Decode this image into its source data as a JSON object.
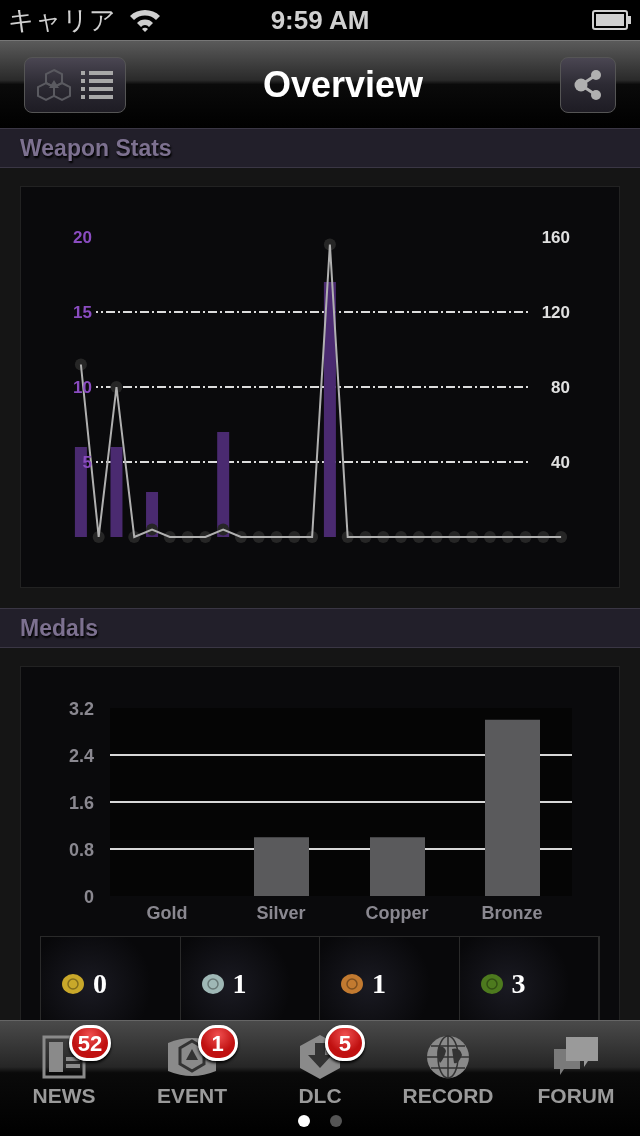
{
  "status_bar": {
    "carrier": "キャリア",
    "time": "9:59 AM"
  },
  "nav_bar": {
    "title": "Overview"
  },
  "sections": [
    {
      "title": "Weapon Stats",
      "chart_data": {
        "type": "bar",
        "ylim": [
          0,
          20
        ],
        "yticks": [
          5,
          10,
          15,
          20
        ],
        "y2lim": [
          0,
          160
        ],
        "y2ticks": [
          40,
          80,
          120,
          160
        ],
        "grid": true,
        "series": [
          {
            "type": "bar",
            "color": "#4a2a70",
            "values": [
              6,
              0,
              6,
              0,
              3,
              0,
              0,
              0,
              7,
              0,
              0,
              0,
              0,
              0,
              17,
              0,
              0,
              0,
              0,
              0,
              0,
              0,
              0,
              0,
              0,
              0,
              0,
              0
            ]
          },
          {
            "type": "line",
            "axis": "y2",
            "marker": true,
            "color": "#b0b0b0",
            "values": [
              92,
              0,
              80,
              0,
              4,
              0,
              0,
              0,
              4,
              0,
              0,
              0,
              0,
              0,
              156,
              0,
              0,
              0,
              0,
              0,
              0,
              0,
              0,
              0,
              0,
              0,
              0,
              0
            ]
          }
        ]
      }
    },
    {
      "title": "Medals",
      "chart_data": {
        "type": "bar",
        "categories": [
          "Gold",
          "Silver",
          "Copper",
          "Bronze"
        ],
        "ylim": [
          0,
          3.2
        ],
        "yticks": [
          0,
          0.8,
          1.6,
          2.4,
          3.2
        ],
        "grid": true,
        "series": [
          {
            "color": "#5a5a5c",
            "values": [
              0,
              1,
              1,
              3
            ]
          }
        ]
      },
      "medals": [
        {
          "count": "0",
          "color": "#c9a82a"
        },
        {
          "count": "1",
          "color": "#9fb8b6"
        },
        {
          "count": "1",
          "color": "#c27a30"
        },
        {
          "count": "3",
          "color": "#4d7a1e"
        }
      ]
    }
  ],
  "tab_bar": {
    "items": [
      {
        "kind": "news",
        "label": "NEWS",
        "badge": "52"
      },
      {
        "kind": "event",
        "label": "EVENT",
        "badge": "1"
      },
      {
        "kind": "dlc",
        "label": "DLC",
        "badge": "5"
      },
      {
        "kind": "record",
        "label": "RECORD"
      },
      {
        "kind": "forum",
        "label": "FORUM"
      }
    ]
  },
  "page_dots": [
    {
      "selected": true
    },
    {
      "selected": false
    }
  ]
}
